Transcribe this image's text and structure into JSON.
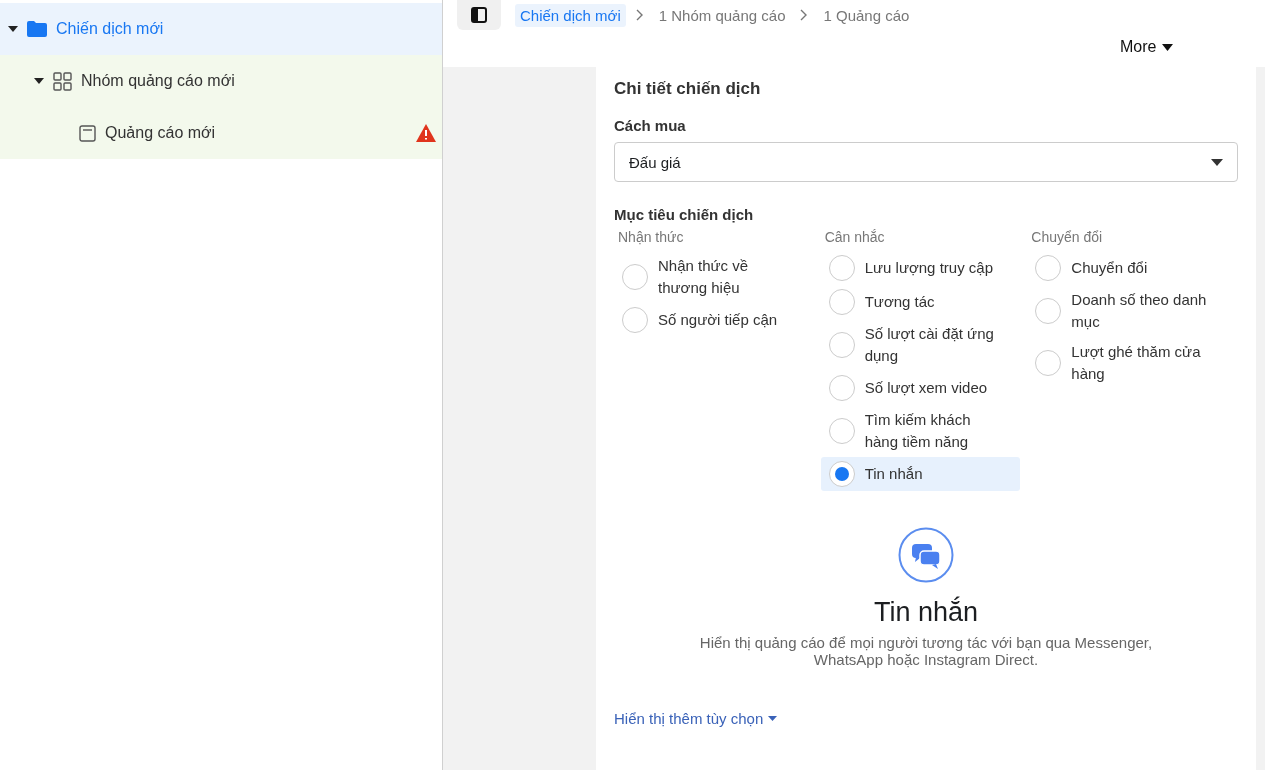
{
  "tree": [
    {
      "label": "Chiến dịch mới",
      "kind": "campaign",
      "selected": true,
      "expanded": true,
      "warning": false,
      "children": [
        {
          "label": "Nhóm quảng cáo mới",
          "kind": "adset",
          "selected": false,
          "expanded": true,
          "warning": false,
          "children": [
            {
              "label": "Quảng cáo mới",
              "kind": "ad",
              "selected": false,
              "warning": true
            }
          ]
        }
      ]
    }
  ],
  "breadcrumbs": [
    {
      "label": "Chiến dịch mới",
      "selected": true
    },
    {
      "label": "1 Nhóm quảng cáo",
      "selected": false
    },
    {
      "label": "1 Quảng cáo",
      "selected": false
    }
  ],
  "more_button": "More",
  "section_title": "Chi tiết chiến dịch",
  "buying_type": {
    "label": "Cách mua",
    "value": "Đấu giá"
  },
  "objective": {
    "label": "Mục tiêu chiến dịch",
    "groups": [
      {
        "title": "Nhận thức",
        "options": [
          {
            "label": "Nhận thức về thương hiệu",
            "selected": false
          },
          {
            "label": "Số người tiếp cận",
            "selected": false
          }
        ]
      },
      {
        "title": "Cân nhắc",
        "options": [
          {
            "label": "Lưu lượng truy cập",
            "selected": false
          },
          {
            "label": "Tương tác",
            "selected": false
          },
          {
            "label": "Số lượt cài đặt ứng dụng",
            "selected": false
          },
          {
            "label": "Số lượt xem video",
            "selected": false
          },
          {
            "label": "Tìm kiếm khách hàng tiềm năng",
            "selected": false
          },
          {
            "label": "Tin nhắn",
            "selected": true
          }
        ]
      },
      {
        "title": "Chuyển đổi",
        "options": [
          {
            "label": "Chuyển đổi",
            "selected": false
          },
          {
            "label": "Doanh số theo danh mục",
            "selected": false
          },
          {
            "label": "Lượt ghé thăm cửa hàng",
            "selected": false
          }
        ]
      }
    ]
  },
  "detail": {
    "title": "Tin nhắn",
    "description": "Hiển thị quảng cáo để mọi người tương tác với bạn qua Messenger, WhatsApp hoặc Instagram Direct."
  },
  "more_options_link": "Hiển thị thêm tùy chọn"
}
